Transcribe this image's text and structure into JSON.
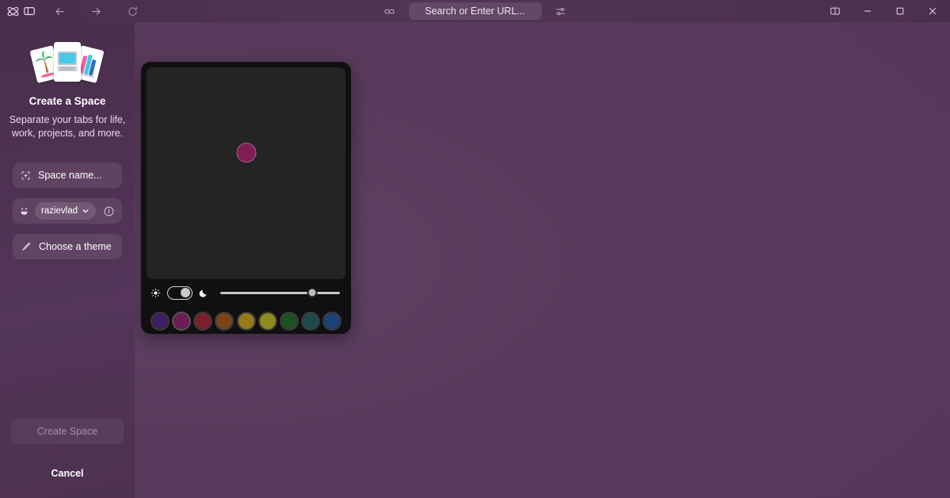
{
  "titlebar": {
    "logo_icon": "arc-logo-icon",
    "sidebar_toggle_icon": "sidebar-panel-icon",
    "back_icon": "arrow-left-icon",
    "forward_icon": "arrow-right-icon",
    "reload_icon": "reload-icon",
    "link_icon": "link-icon",
    "url_placeholder": "Search or Enter URL...",
    "settings_icon": "sliders-icon",
    "split_view_icon": "split-view-icon",
    "minimize_icon": "minimize-icon",
    "maximize_icon": "maximize-icon",
    "close_icon": "close-icon"
  },
  "sidebar": {
    "illustration": {
      "name": "space-cards-illustration",
      "cards": [
        "palm-tree-card",
        "computer-card",
        "books-card"
      ]
    },
    "title": "Create a Space",
    "subtitle": "Separate your tabs for life, work, projects, and more.",
    "space_name": {
      "icon": "space-grid-icon",
      "value": "",
      "placeholder": "Space name..."
    },
    "profile": {
      "icon": "smiley-face-icon",
      "name": "razievlad",
      "chevron_icon": "chevron-down-icon",
      "info_icon": "info-circle-icon"
    },
    "theme_button": {
      "icon": "paintbrush-icon",
      "label": "Choose a theme"
    },
    "create_button": {
      "label": "Create Space",
      "enabled": false
    },
    "cancel_button": {
      "label": "Cancel"
    }
  },
  "theme_popover": {
    "preview": {
      "background": "#242425",
      "dot_color": "#7d1f54"
    },
    "mode_toggle": {
      "light_icon": "sun-icon",
      "dark_icon": "moon-icon",
      "state": "dark",
      "knob_position": "right"
    },
    "intensity_slider": {
      "value_percent": 77
    },
    "swatches": [
      {
        "name": "purple",
        "color": "#3e2060",
        "selected": false
      },
      {
        "name": "magenta",
        "color": "#6d1c56",
        "selected": true
      },
      {
        "name": "red",
        "color": "#7a2026",
        "selected": false
      },
      {
        "name": "brown",
        "color": "#7a4417",
        "selected": false
      },
      {
        "name": "gold",
        "color": "#97781a",
        "selected": false
      },
      {
        "name": "olive",
        "color": "#8e8b1f",
        "selected": false
      },
      {
        "name": "green",
        "color": "#1d5220",
        "selected": false
      },
      {
        "name": "teal",
        "color": "#1d4a4c",
        "selected": false
      },
      {
        "name": "blue",
        "color": "#1d4076",
        "selected": false
      }
    ]
  },
  "colors": {
    "sidebar_bg": "#4b2f4e",
    "main_bg": "#58395b",
    "popover_bg": "#101011",
    "accent": "#6d1c56"
  }
}
